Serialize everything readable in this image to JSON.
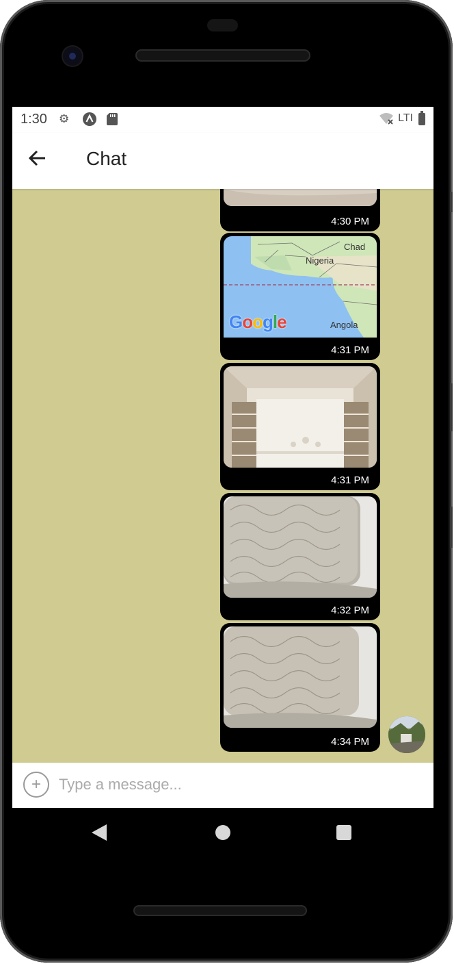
{
  "status_bar": {
    "time": "1:30",
    "icons": [
      "gear-icon",
      "a-circle-icon",
      "sd-card-icon"
    ],
    "network": "LTI",
    "signal_icon": "wifi-off-icon",
    "battery_icon": "battery-icon"
  },
  "header": {
    "back_icon": "arrow-left-icon",
    "title": "Chat"
  },
  "messages": [
    {
      "type": "image",
      "time": "4:30 PM",
      "content": "photo"
    },
    {
      "type": "location",
      "time": "4:31 PM",
      "map_labels": {
        "chad": "Chad",
        "nigeria": "Nigeria",
        "angola": "Angola",
        "logo": "Google"
      }
    },
    {
      "type": "image",
      "time": "4:31 PM",
      "content": "photo"
    },
    {
      "type": "image",
      "time": "4:32 PM",
      "content": "photo"
    },
    {
      "type": "image",
      "time": "4:34 PM",
      "content": "photo"
    }
  ],
  "composer": {
    "attach_icon": "plus-circle-icon",
    "placeholder": "Type a message..."
  },
  "colors": {
    "chat_background": "#cfcb91",
    "bubble": "#000000",
    "map_water": "#8ec1f1"
  },
  "navigation": [
    "back-triangle-icon",
    "home-circle-icon",
    "recents-square-icon"
  ]
}
